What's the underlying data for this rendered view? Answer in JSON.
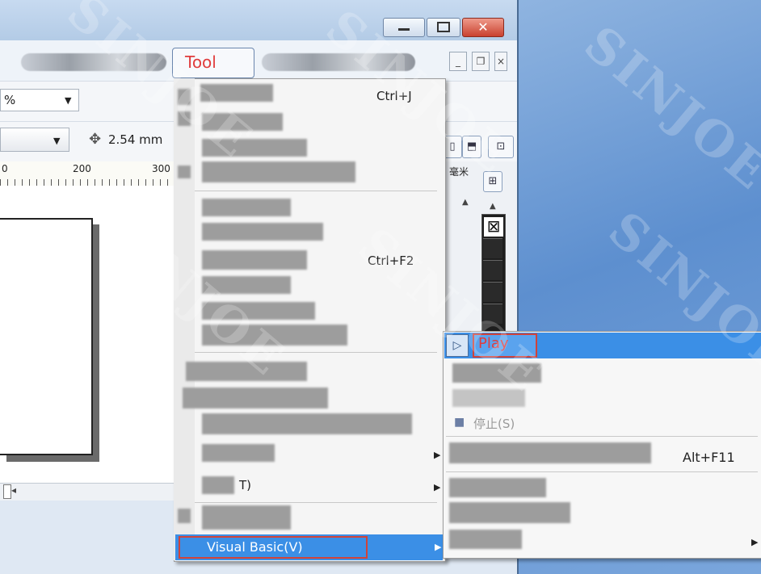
{
  "menubar": {
    "tool_label": "Tool"
  },
  "toolbar": {
    "zoom_value": "%",
    "nudge_value": "2.54 mm"
  },
  "ruler": {
    "labels": [
      "0",
      "200",
      "300"
    ],
    "unit_label": "毫米"
  },
  "tools_menu": {
    "shortcut_ctrl_j": "Ctrl+J",
    "shortcut_ctrl_f2": "Ctrl+F2",
    "partial_label_t": "T)",
    "visual_basic_label": "Visual Basic(V)"
  },
  "vb_submenu": {
    "play_label": "Play",
    "stop_label": "停止(S)",
    "shortcut_alt_f11": "Alt+F11"
  },
  "watermark": "SINJOE",
  "colors": {
    "highlight": "#3b8fe6",
    "annotation_red": "#d0433a",
    "desktop": "#5d8fcf"
  }
}
